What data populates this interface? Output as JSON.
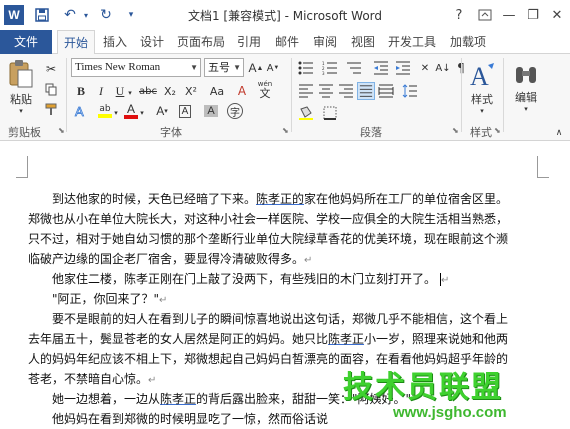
{
  "title_bar": {
    "title": "文档1 [兼容模式] - Microsoft Word",
    "logo_letter": "W",
    "save_icon": "save-icon",
    "undo_glyph": "↶",
    "redo_glyph": "↻",
    "help_glyph": "?",
    "minimize_glyph": "—",
    "restore_glyph": "❐",
    "close_glyph": "✕"
  },
  "tabs": [
    {
      "label": "文件"
    },
    {
      "label": "开始"
    },
    {
      "label": "插入"
    },
    {
      "label": "设计"
    },
    {
      "label": "页面布局"
    },
    {
      "label": "引用"
    },
    {
      "label": "邮件"
    },
    {
      "label": "审阅"
    },
    {
      "label": "视图"
    },
    {
      "label": "开发工具"
    },
    {
      "label": "加载项"
    }
  ],
  "ribbon": {
    "paste_label": "粘贴",
    "font_name": "Times New Roman",
    "font_size": "五号",
    "bold": "B",
    "italic": "I",
    "underline": "U",
    "strike": "abc",
    "subscript": "X₂",
    "superscript": "X²",
    "clear_format": "A",
    "grow_font": "A",
    "shrink_font": "A",
    "change_case": "Aa",
    "phonetic": "wén",
    "char_border": "A",
    "highlight": "ab",
    "font_color": "A",
    "char_shading": "A",
    "enclose_char": "字",
    "styles_label": "样式",
    "edit_label": "编辑",
    "groups": {
      "clipboard": "剪贴板",
      "font": "字体",
      "paragraph": "段落",
      "styles": "样式"
    }
  },
  "document": {
    "lines": [
      {
        "pre": "到达他家的时候，天色已经暗了下来。",
        "name": "陈孝正的",
        "post": "家在他妈妈所在工厂的单位宿舍区里。",
        "mark": ""
      },
      {
        "pre": "郑微也从小在单位大院长大，对这种小社会一样医院、学校一应俱全的大院生活相当熟悉，",
        "name": "",
        "post": "",
        "mark": ""
      },
      {
        "pre": "只不过，相对于她自幼习惯的那个垄断行业单位大院绿草香花的优美环境，现在眼前这个濒",
        "name": "",
        "post": "",
        "mark": ""
      },
      {
        "pre": "临破产边缘的国企老厂宿舍，要显得冷清破败得多。",
        "name": "",
        "post": "",
        "mark": "↵"
      },
      {
        "pre": "他家住二楼，陈孝正刚在门上敲了没两下，有些残旧的木门立刻打开了。",
        "name": "",
        "post": "",
        "mark": "↵"
      },
      {
        "pre": "\"阿正，你回来了？\"",
        "name": "",
        "post": "",
        "mark": "↵"
      },
      {
        "pre": "要不是眼前的妇人在看到儿子的瞬间惊喜地说出这句话，郑微几乎不能相信，这个看上",
        "name": "",
        "post": "",
        "mark": ""
      },
      {
        "pre": "去年届五十，鬓显苍老的女人居然是阿正的妈妈。她只比",
        "name": "陈孝正",
        "post": "小一岁，照理来说她和他两",
        "mark": ""
      },
      {
        "pre": "人的妈妈年纪应该不相上下，郑微想起自己妈妈白皙漂亮的面容，在看看他妈妈超乎年龄的",
        "name": "",
        "post": "",
        "mark": ""
      },
      {
        "pre": "苍老，不禁暗自心惊。",
        "name": "",
        "post": "",
        "mark": "↵"
      },
      {
        "pre": "她一边想着，一边从",
        "name": "陈孝正",
        "post": "的背后露出脸来，甜甜一笑：\"阿姨好。\"",
        "mark": ""
      },
      {
        "pre": "他妈妈在看到郑微的时候明显吃了一惊，然而俗话说",
        "name": "",
        "post": "",
        "mark": ""
      }
    ]
  },
  "watermark": {
    "title": "技术员联盟",
    "url": "www.jsgho.com"
  }
}
